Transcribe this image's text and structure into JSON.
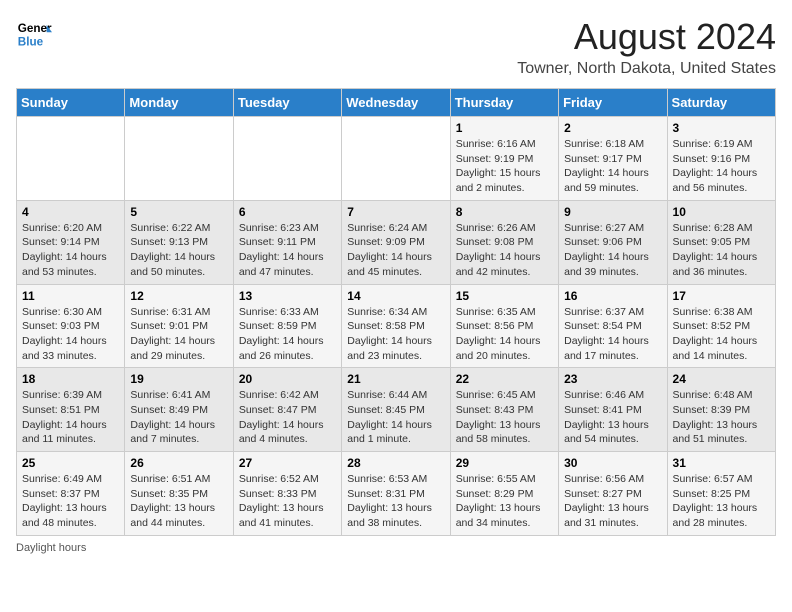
{
  "header": {
    "logo_line1": "General",
    "logo_line2": "Blue",
    "title": "August 2024",
    "subtitle": "Towner, North Dakota, United States"
  },
  "weekdays": [
    "Sunday",
    "Monday",
    "Tuesday",
    "Wednesday",
    "Thursday",
    "Friday",
    "Saturday"
  ],
  "weeks": [
    [
      {
        "day": "",
        "info": ""
      },
      {
        "day": "",
        "info": ""
      },
      {
        "day": "",
        "info": ""
      },
      {
        "day": "",
        "info": ""
      },
      {
        "day": "1",
        "info": "Sunrise: 6:16 AM\nSunset: 9:19 PM\nDaylight: 15 hours\nand 2 minutes."
      },
      {
        "day": "2",
        "info": "Sunrise: 6:18 AM\nSunset: 9:17 PM\nDaylight: 14 hours\nand 59 minutes."
      },
      {
        "day": "3",
        "info": "Sunrise: 6:19 AM\nSunset: 9:16 PM\nDaylight: 14 hours\nand 56 minutes."
      }
    ],
    [
      {
        "day": "4",
        "info": "Sunrise: 6:20 AM\nSunset: 9:14 PM\nDaylight: 14 hours\nand 53 minutes."
      },
      {
        "day": "5",
        "info": "Sunrise: 6:22 AM\nSunset: 9:13 PM\nDaylight: 14 hours\nand 50 minutes."
      },
      {
        "day": "6",
        "info": "Sunrise: 6:23 AM\nSunset: 9:11 PM\nDaylight: 14 hours\nand 47 minutes."
      },
      {
        "day": "7",
        "info": "Sunrise: 6:24 AM\nSunset: 9:09 PM\nDaylight: 14 hours\nand 45 minutes."
      },
      {
        "day": "8",
        "info": "Sunrise: 6:26 AM\nSunset: 9:08 PM\nDaylight: 14 hours\nand 42 minutes."
      },
      {
        "day": "9",
        "info": "Sunrise: 6:27 AM\nSunset: 9:06 PM\nDaylight: 14 hours\nand 39 minutes."
      },
      {
        "day": "10",
        "info": "Sunrise: 6:28 AM\nSunset: 9:05 PM\nDaylight: 14 hours\nand 36 minutes."
      }
    ],
    [
      {
        "day": "11",
        "info": "Sunrise: 6:30 AM\nSunset: 9:03 PM\nDaylight: 14 hours\nand 33 minutes."
      },
      {
        "day": "12",
        "info": "Sunrise: 6:31 AM\nSunset: 9:01 PM\nDaylight: 14 hours\nand 29 minutes."
      },
      {
        "day": "13",
        "info": "Sunrise: 6:33 AM\nSunset: 8:59 PM\nDaylight: 14 hours\nand 26 minutes."
      },
      {
        "day": "14",
        "info": "Sunrise: 6:34 AM\nSunset: 8:58 PM\nDaylight: 14 hours\nand 23 minutes."
      },
      {
        "day": "15",
        "info": "Sunrise: 6:35 AM\nSunset: 8:56 PM\nDaylight: 14 hours\nand 20 minutes."
      },
      {
        "day": "16",
        "info": "Sunrise: 6:37 AM\nSunset: 8:54 PM\nDaylight: 14 hours\nand 17 minutes."
      },
      {
        "day": "17",
        "info": "Sunrise: 6:38 AM\nSunset: 8:52 PM\nDaylight: 14 hours\nand 14 minutes."
      }
    ],
    [
      {
        "day": "18",
        "info": "Sunrise: 6:39 AM\nSunset: 8:51 PM\nDaylight: 14 hours\nand 11 minutes."
      },
      {
        "day": "19",
        "info": "Sunrise: 6:41 AM\nSunset: 8:49 PM\nDaylight: 14 hours\nand 7 minutes."
      },
      {
        "day": "20",
        "info": "Sunrise: 6:42 AM\nSunset: 8:47 PM\nDaylight: 14 hours\nand 4 minutes."
      },
      {
        "day": "21",
        "info": "Sunrise: 6:44 AM\nSunset: 8:45 PM\nDaylight: 14 hours\nand 1 minute."
      },
      {
        "day": "22",
        "info": "Sunrise: 6:45 AM\nSunset: 8:43 PM\nDaylight: 13 hours\nand 58 minutes."
      },
      {
        "day": "23",
        "info": "Sunrise: 6:46 AM\nSunset: 8:41 PM\nDaylight: 13 hours\nand 54 minutes."
      },
      {
        "day": "24",
        "info": "Sunrise: 6:48 AM\nSunset: 8:39 PM\nDaylight: 13 hours\nand 51 minutes."
      }
    ],
    [
      {
        "day": "25",
        "info": "Sunrise: 6:49 AM\nSunset: 8:37 PM\nDaylight: 13 hours\nand 48 minutes."
      },
      {
        "day": "26",
        "info": "Sunrise: 6:51 AM\nSunset: 8:35 PM\nDaylight: 13 hours\nand 44 minutes."
      },
      {
        "day": "27",
        "info": "Sunrise: 6:52 AM\nSunset: 8:33 PM\nDaylight: 13 hours\nand 41 minutes."
      },
      {
        "day": "28",
        "info": "Sunrise: 6:53 AM\nSunset: 8:31 PM\nDaylight: 13 hours\nand 38 minutes."
      },
      {
        "day": "29",
        "info": "Sunrise: 6:55 AM\nSunset: 8:29 PM\nDaylight: 13 hours\nand 34 minutes."
      },
      {
        "day": "30",
        "info": "Sunrise: 6:56 AM\nSunset: 8:27 PM\nDaylight: 13 hours\nand 31 minutes."
      },
      {
        "day": "31",
        "info": "Sunrise: 6:57 AM\nSunset: 8:25 PM\nDaylight: 13 hours\nand 28 minutes."
      }
    ]
  ],
  "footer": {
    "note": "Daylight hours"
  }
}
